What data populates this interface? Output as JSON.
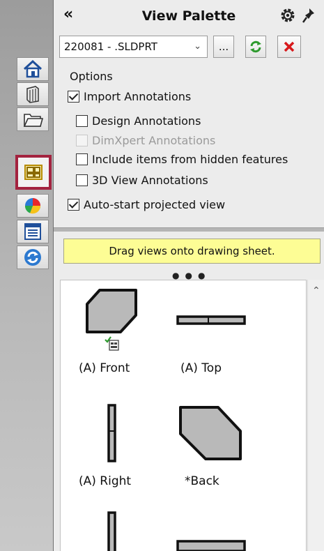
{
  "tabs": [
    {
      "name": "home-icon",
      "active": false
    },
    {
      "name": "parts-library-icon",
      "active": false
    },
    {
      "name": "folder-icon",
      "active": false
    },
    {
      "name": "view-palette-icon",
      "active": true
    },
    {
      "name": "appearance-icon",
      "active": false
    },
    {
      "name": "custom-properties-icon",
      "active": false
    },
    {
      "name": "refresh-icon",
      "active": false
    }
  ],
  "header": {
    "collapse": "«",
    "title": "View Palette"
  },
  "toolbar": {
    "document": "220081 - .SLDPRT",
    "browse_label": "...",
    "refresh_icon": "refresh-icon",
    "clear_icon": "close-icon"
  },
  "options": {
    "label": "Options",
    "import_annotations": {
      "label": "Import Annotations",
      "checked": true
    },
    "design_annotations": {
      "label": "Design Annotations",
      "checked": false
    },
    "dimxpert_annotations": {
      "label": "DimXpert Annotations",
      "checked": false,
      "disabled": true
    },
    "hidden_features": {
      "label": "Include items from hidden features",
      "checked": false
    },
    "view_3d_annotations": {
      "label": "3D View Annotations",
      "checked": false
    },
    "auto_start": {
      "label": "Auto-start projected view",
      "checked": true
    }
  },
  "hint": "Drag views onto drawing sheet.",
  "views": [
    {
      "label": "(A) Front"
    },
    {
      "label": "(A) Top"
    },
    {
      "label": "(A) Right"
    },
    {
      "label": "*Back"
    }
  ],
  "colors": {
    "accent_red": "#a3233f",
    "hint_yellow": "#fdfd95",
    "refresh_green": "#2e9a2e",
    "close_red": "#d7191c"
  }
}
